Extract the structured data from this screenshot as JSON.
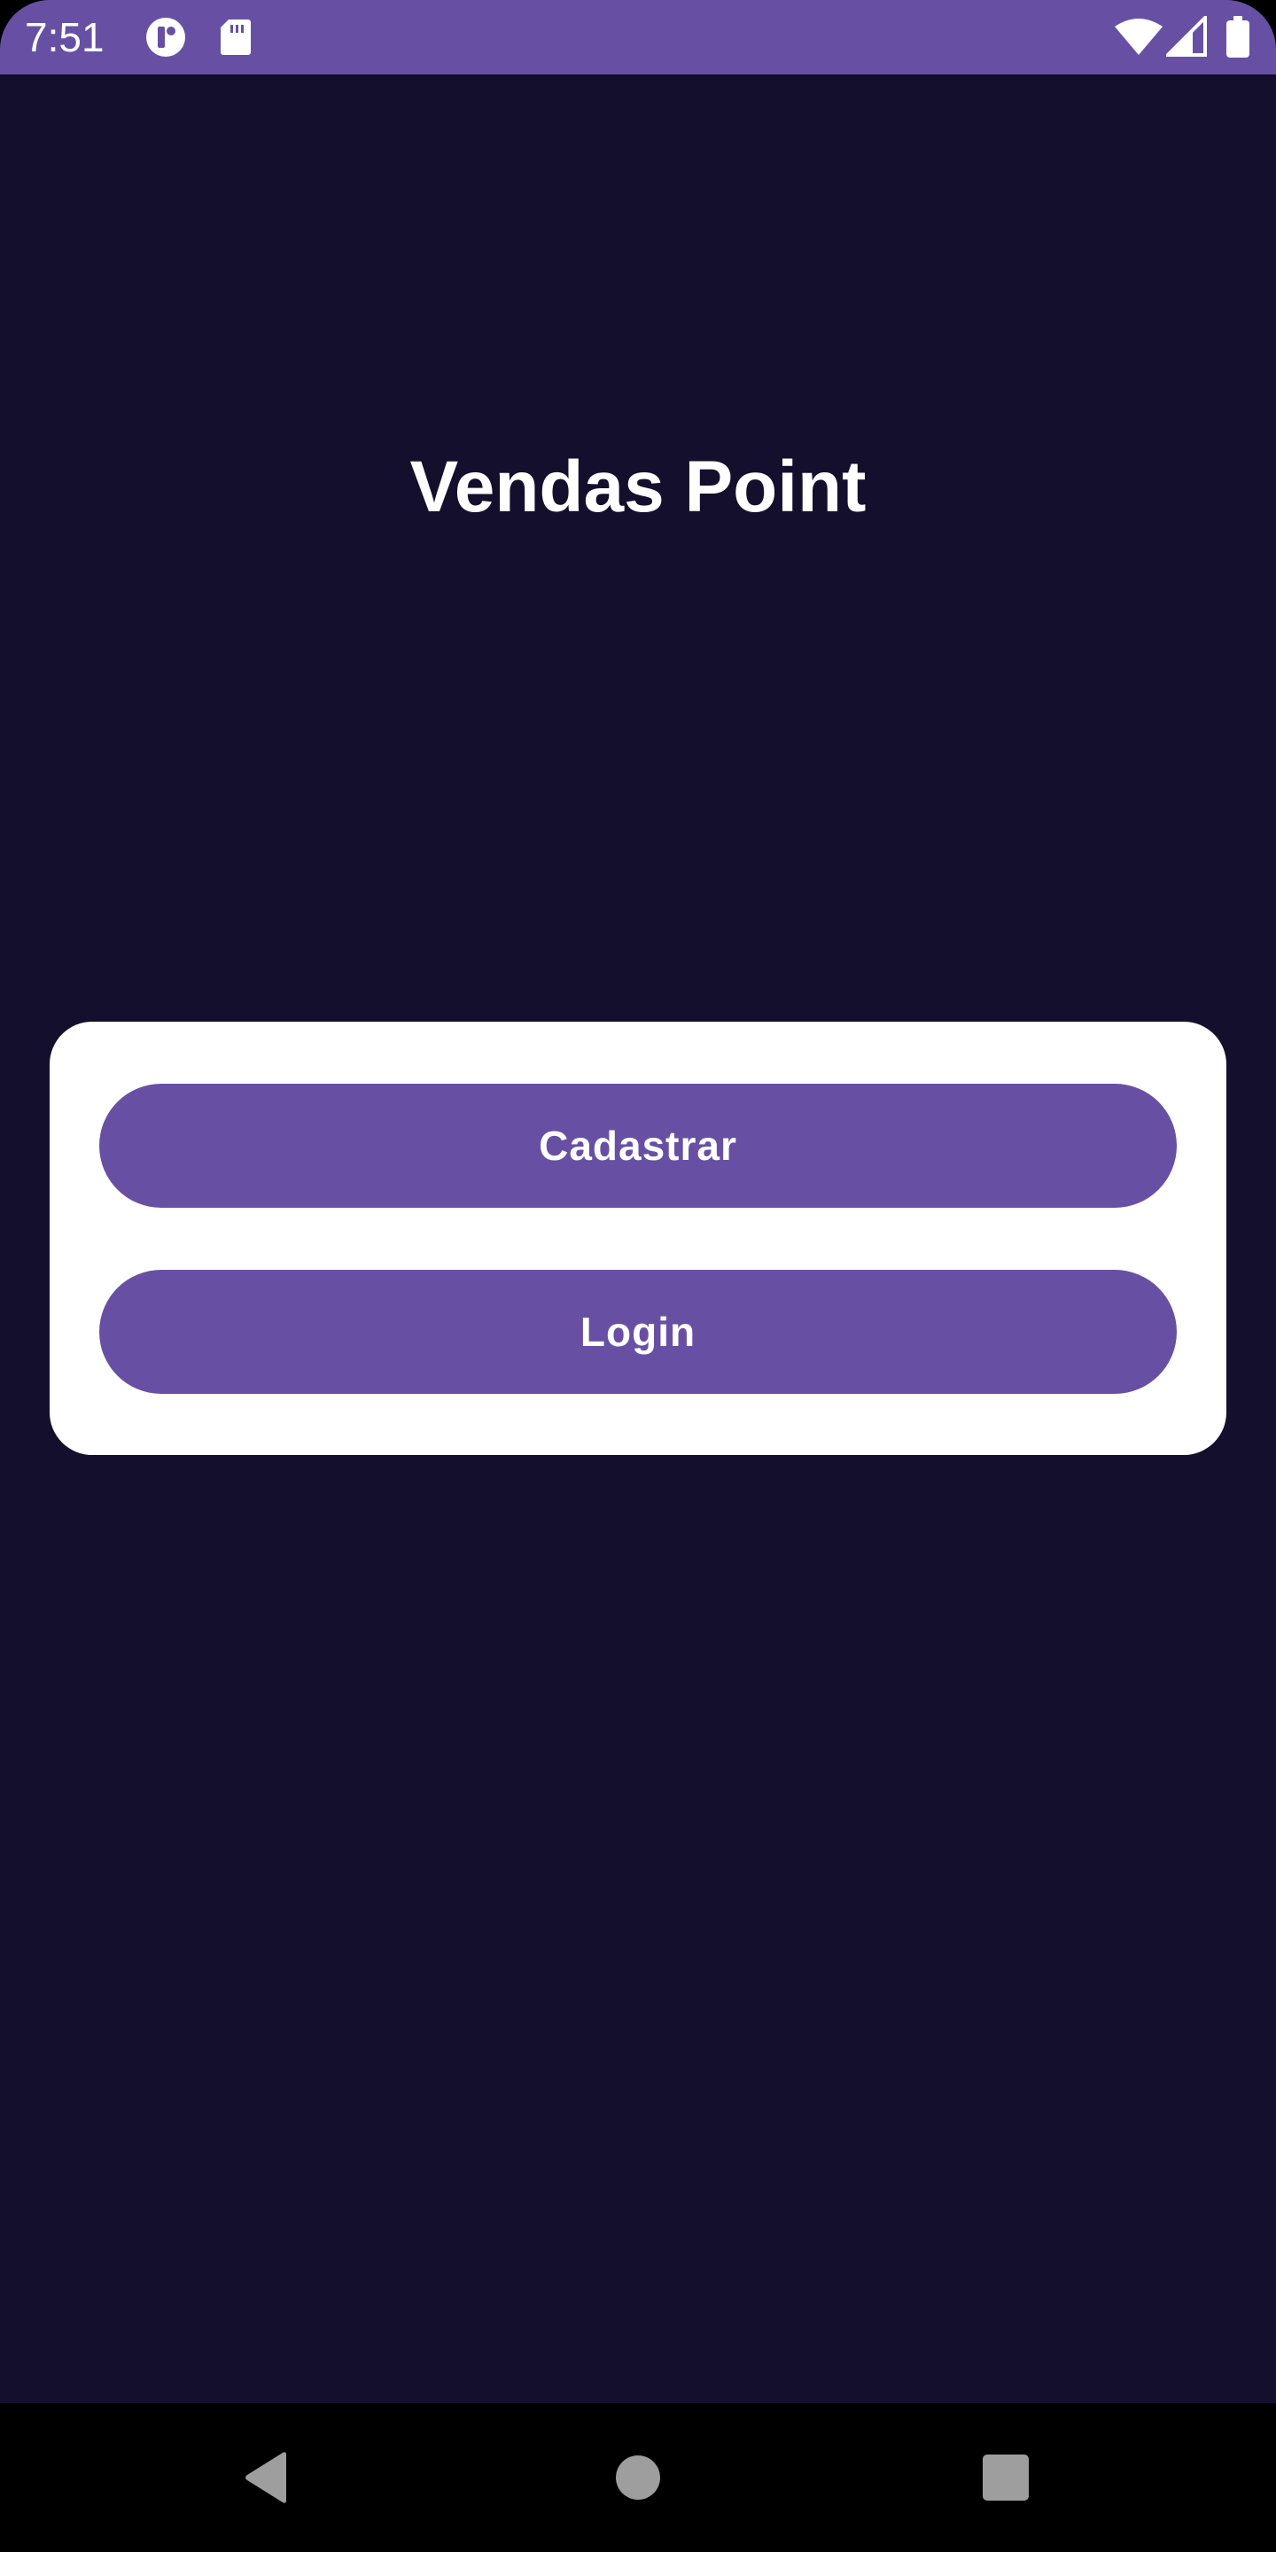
{
  "status_bar": {
    "time": "7:51",
    "background_color": "#6750a4",
    "left_icons": [
      "app-notification-icon",
      "sd-card-icon"
    ],
    "right_icons": [
      "wifi-icon",
      "cellular-signal-icon",
      "battery-icon"
    ]
  },
  "app": {
    "title": "Vendas Point",
    "background_color": "#140f2c"
  },
  "card": {
    "background_color": "#ffffff",
    "buttons": [
      {
        "label": "Cadastrar",
        "color": "#6750a4"
      },
      {
        "label": "Login",
        "color": "#6750a4"
      }
    ]
  },
  "navigation_bar": {
    "background_color": "#000000",
    "buttons": [
      "back-icon",
      "home-icon",
      "recents-icon"
    ]
  }
}
